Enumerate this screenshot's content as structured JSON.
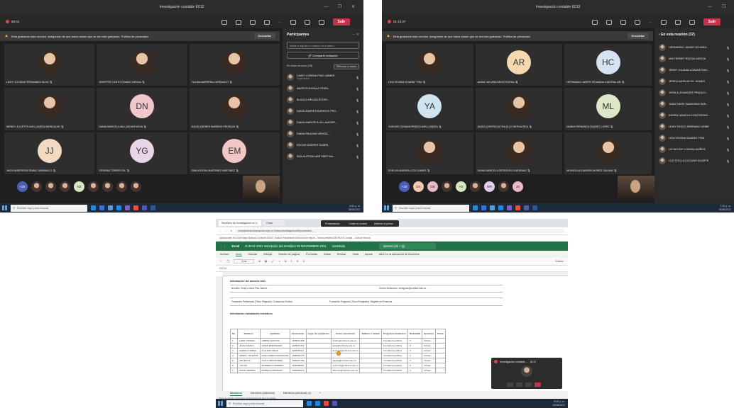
{
  "teams1": {
    "title": "Investigación contable E012",
    "timer": "59:01",
    "leave_label": "Salir",
    "banner_bold": "Está grabando",
    "banner_text": "Está grabando esta reunión. Asegúrese de que todos sepan que se les está grabando. Política de privacidad",
    "dismiss_label": "Descartar",
    "tiles": [
      {
        "name": "LEIDY JULIANA FERNANDEZ SILVA",
        "initials": "",
        "color": ""
      },
      {
        "name": "JENIFFER LIZETH GOMEZ GARCIA",
        "initials": "",
        "color": ""
      },
      {
        "name": "YULISA BARRERA CARRASCO",
        "initials": "",
        "color": ""
      },
      {
        "name": "WENDY JULIETTE AVELLANEDA MONSALVE",
        "initials": "",
        "color": ""
      },
      {
        "name": "DIANA MARCELA MILLANGAR NOVA",
        "initials": "DN",
        "color": "#f0c8cc"
      },
      {
        "name": "DAVID ANDRES BARRIOS PEDRAZA",
        "initials": "",
        "color": ""
      },
      {
        "name": "JHON ANDERSON RUBIO JARAMILLO",
        "initials": "JJ",
        "color": "#f3d9c2"
      },
      {
        "name": "YESENIA TORRES GIL",
        "initials": "YG",
        "color": "#e8d5e8"
      },
      {
        "name": "EMILIA ROSA MARTINEZ MARTINEZ",
        "initials": "EM",
        "color": "#f4c7c7"
      }
    ],
    "more_count": "+20",
    "bubbles": [
      "",
      "",
      "",
      "NZ",
      "",
      "",
      "",
      ""
    ],
    "panel": {
      "title": "Participantes",
      "invite_placeholder": "Invita a alguien o marca un número",
      "share_label": "Compartir invitación",
      "section": "En esta reunión (28)",
      "mute_all": "Silenciar a todos",
      "people": [
        {
          "name": "CINDY LORENA PINO JAIMES",
          "sub": "Organizador"
        },
        {
          "name": "ANGELICA AYALA CIDEN...",
          "sub": ""
        },
        {
          "name": "BLANCA NELIDA RODRI... ",
          "sub": ""
        },
        {
          "name": "DAVID ANDRES BARRIOS PED...",
          "sub": ""
        },
        {
          "name": "DIANA MARCELA VILLAMIZAR...",
          "sub": ""
        },
        {
          "name": "DIANA PAULINA VERGEL...",
          "sub": ""
        },
        {
          "name": "EDGAR ANDRES SUARE...",
          "sub": ""
        },
        {
          "name": "EMILIA ROSA MARTINEZ MA...",
          "sub": ""
        }
      ]
    },
    "search_placeholder": "Escribe aquí para buscar",
    "clock_time": "6:51 p. m.",
    "clock_date": "18/08/2021"
  },
  "teams2": {
    "title": "Investigación contable E013",
    "timer": "01:10:07",
    "leave_label": "Salir",
    "banner_bold": "Está grabando",
    "banner_text": "Está grabando esta reunión. Asegúrese de que todos sepan que se les está grabando. Política de privacidad",
    "dismiss_label": "Descartar",
    "tiles": [
      {
        "name": "LIDA VIVIANA SUAREZ TRIA",
        "initials": "",
        "color": ""
      },
      {
        "name": "ANGIE JULIANA ARIAS RUEDA",
        "initials": "AR",
        "color": "#f6d8b0"
      },
      {
        "name": "HERNANDO JAVIER VELANDIA CASTRILLON",
        "initials": "HC",
        "color": "#d6e4f2"
      },
      {
        "name": "YURLEIS SUSANA PINEDO AVELLANEDA",
        "initials": "YA",
        "color": "#cfe3f0"
      },
      {
        "name": "ANGELA PATRICIA TRUJILLO SEPULVEDA",
        "initials": "",
        "color": ""
      },
      {
        "name": "MARIA FERNANDA SUAREZ LOPEZ",
        "initials": "ML",
        "color": "#dde8c8"
      },
      {
        "name": "EVELYN ANDREA LOTA JAIMES",
        "initials": "",
        "color": ""
      },
      {
        "name": "DIANA MARCELA ORTEGON CARDENAS",
        "initials": "",
        "color": ""
      },
      {
        "name": "MONICA ALEJANDRA MUÑOZ GALVAN",
        "initials": "",
        "color": ""
      }
    ],
    "more_count": "+18",
    "bubbles": [
      "DS",
      "DB",
      "",
      "AS",
      "",
      "WR",
      "",
      "JS"
    ],
    "panel": {
      "title": "En esta reunión (37)",
      "people": [
        {
          "name": "HERNANDO JAVIER VELANDI...",
          "sub": ""
        },
        {
          "name": "IAN FERNEY RUEDA GARCIA",
          "sub": ""
        },
        {
          "name": "JENNY JULIANA LOZADA SAN...",
          "sub": ""
        },
        {
          "name": "JESICA NATALIA GIL JAIMES",
          "sub": ""
        },
        {
          "name": "JHON ALEXANDER PRADA D...",
          "sub": ""
        },
        {
          "name": "JUAN DAVID SAAVEDRA SAN...",
          "sub": ""
        },
        {
          "name": "KAREN DANIELA CONTRERAS...",
          "sub": ""
        },
        {
          "name": "LEIDY ROCIO SERRANO URIBE",
          "sub": ""
        },
        {
          "name": "LIDA VIVIANA SUAREZ TRIA",
          "sub": ""
        },
        {
          "name": "LIZ NICOLE LOZADA MUÑOZ",
          "sub": ""
        },
        {
          "name": "LUZ STELLA LIZCANO DUARTE",
          "sub": ""
        }
      ]
    },
    "search_placeholder": "Escribe aquí para buscar",
    "clock_time": "7:10 p. m.",
    "clock_date": "18/08/2021"
  },
  "excel": {
    "tabs": [
      "Semillero de Investigación en U",
      "Crear"
    ],
    "overlay": [
      "Presentando...",
      "Ceder el control",
      "Detener la prese..."
    ],
    "url": "unisabaneta.sharepoint.com/:x:/r/sites/Investigacion/Documentos...",
    "bookmarks": "Aplicaciones  YouTube  Maps  Noticias  Consulta SIGCE  Traducir  Facturación  Dirección de Impue...  Nueva pestaña  UNITRA IV Contab...  Lista de lectura",
    "app_name": "Excel",
    "file_name": "R-IN-01 2021 Inscripción del Semillero 30 NOVIEMBRE 2021",
    "saved": "Guardado",
    "search": "Buscar (Alt + Q)",
    "ribbon_tabs": [
      "Archivo",
      "Inicio",
      "Insertar",
      "Dibujar",
      "Diseño de página",
      "Fórmulas",
      "Datos",
      "Revisar",
      "Vista",
      "Ayuda",
      "Abrir en la aplicación de escritorio"
    ],
    "ribbon_active": "Inicio",
    "edit_mode": "Edición",
    "font": "Arial",
    "cell_ref": "H13",
    "sec1": "Información del docente líder",
    "sec2": "Información estudiantes miembros",
    "docente_name": "Nombre: Cindy Lorena Pino Jaimes",
    "docente_email": "Correo electrónico: cindypino@unitrans.edu.co",
    "formacion": "Formación Profesional (Título Pregrado): Contaduría Pública",
    "posgrado": "Formación Posgrado (Título Postgrado): Magister en Finanzas",
    "headers": [
      "No.",
      "Nombres",
      "Apellidos",
      "Documento",
      "Lugar de expedición",
      "Correo electrónico",
      "Teléfono / Celular",
      "Programa Académico",
      "Modalidad",
      "Semestre",
      "Firma"
    ],
    "rows": [
      [
        "1",
        "LEIDY JOHANA",
        "URBINA SANTOS",
        "1005371345",
        "",
        "lurbina@unitrans.edu.co",
        "",
        "Contaduría pública",
        "X",
        "Octavo"
      ],
      [
        "2",
        "JUAN CAMILO",
        "ARIAS RODRIGUEZ",
        "1005372342",
        "",
        "jarias@unitrans.edu.co",
        "",
        "Contaduría pública",
        "X",
        "Octavo"
      ],
      [
        "3",
        "KAREN LORENA",
        "ZULUETA ARIAS",
        "1005359111",
        "",
        "kzulueta@unitrans.edu.co",
        "",
        "Contaduría pública",
        "X",
        "Octavo"
      ],
      [
        "4",
        "WENDY JULIETTE",
        "AVELLANEDA MONSALVE",
        "1098666775",
        "",
        "",
        "",
        "Contaduría pública",
        "X",
        "Octavo"
      ],
      [
        "5",
        "ANGELICA",
        "AYALA HERNANDEZ",
        "1005367746",
        "",
        "aayala@unitrans.edu.co",
        "",
        "Contaduría pública",
        "X",
        "Octavo"
      ],
      [
        "6",
        "YULISA",
        "BARRERA CARRERO",
        "1005358667",
        "",
        "ybarrera@unitrans.edu.co",
        "",
        "Contaduría pública",
        "X",
        "Octavo"
      ],
      [
        "7",
        "DAVID ANDRES",
        "BARRIOS PEDRAZA",
        "1005360270",
        "",
        "dbarrios@unitrans.edu.co",
        "",
        "Contaduría pública",
        "X",
        "Octavo"
      ]
    ],
    "sheet_tabs": [
      "Miembros",
      "Miembros (Adicional)",
      "Miembros (Adicional) (2)",
      "+"
    ],
    "status": "Modo de cálculo: Automático   Estadísticas del libro de trabajo",
    "mini_title": "Investigación contable ...",
    "mini_timer": "30:17",
    "search_placeholder": "Escribe aquí para buscar",
    "clock_time": "8:06 p. m.",
    "clock_date": "18/08/2021"
  }
}
